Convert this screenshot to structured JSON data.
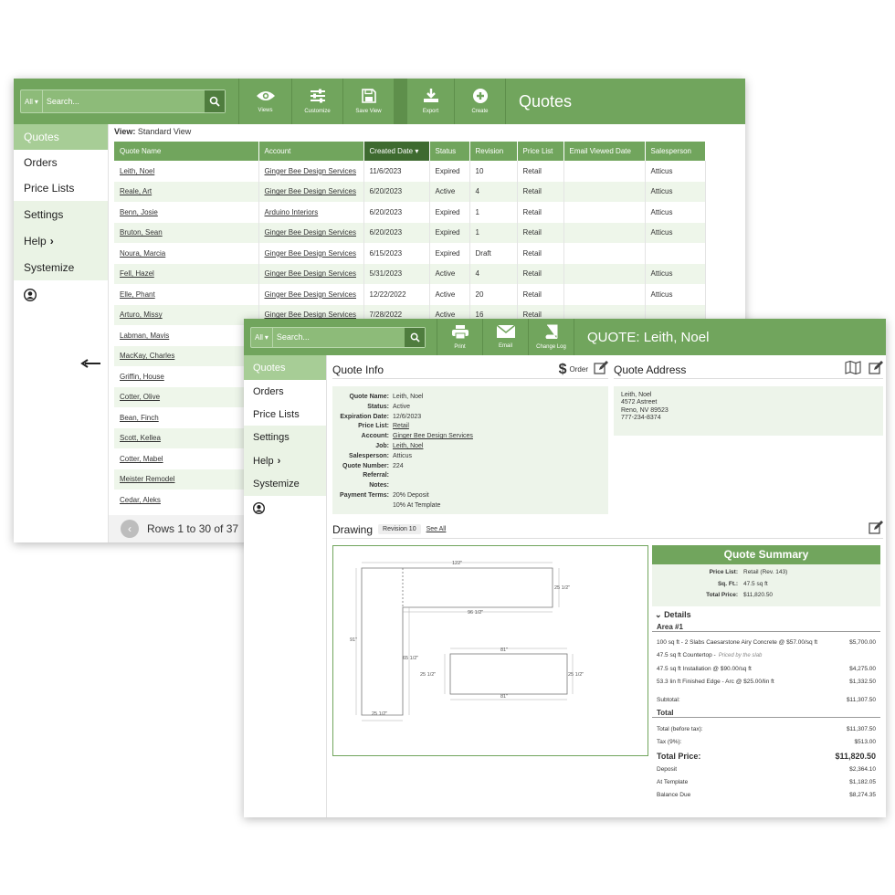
{
  "search": {
    "scope": "All",
    "placeholder": "Search..."
  },
  "window1": {
    "toolbar": {
      "views": "Views",
      "customize": "Customize",
      "save_view": "Save View",
      "export": "Export",
      "create": "Create",
      "title": "Quotes"
    },
    "sidebar": [
      "Quotes",
      "Orders",
      "Price Lists",
      "Settings",
      "Help",
      "Systemize"
    ],
    "view_label": "View:",
    "view_value": "Standard View",
    "columns": [
      "Quote Name",
      "Account",
      "Created Date",
      "Status",
      "Revision",
      "Price List",
      "Email Viewed Date",
      "Salesperson"
    ],
    "rows": [
      [
        "Leith, Noel",
        "Ginger Bee Design Services",
        "11/6/2023",
        "Expired",
        "10",
        "Retail",
        "",
        "Atticus"
      ],
      [
        "Reale, Art",
        "Ginger Bee Design Services",
        "6/20/2023",
        "Active",
        "4",
        "Retail",
        "",
        "Atticus"
      ],
      [
        "Benn, Josie",
        "Arduino Interiors",
        "6/20/2023",
        "Expired",
        "1",
        "Retail",
        "",
        "Atticus"
      ],
      [
        "Bruton, Sean",
        "Ginger Bee Design Services",
        "6/20/2023",
        "Expired",
        "1",
        "Retail",
        "",
        "Atticus"
      ],
      [
        "Noura, Marcia",
        "Ginger Bee Design Services",
        "6/15/2023",
        "Expired",
        "Draft",
        "Retail",
        "",
        ""
      ],
      [
        "Fell, Hazel",
        "Ginger Bee Design Services",
        "5/31/2023",
        "Active",
        "4",
        "Retail",
        "",
        "Atticus"
      ],
      [
        "Elle, Phant",
        "Ginger Bee Design Services",
        "12/22/2022",
        "Active",
        "20",
        "Retail",
        "",
        "Atticus"
      ],
      [
        "Arturo, Missy",
        "Ginger Bee Design Services",
        "7/28/2022",
        "Active",
        "16",
        "Retail",
        "",
        ""
      ],
      [
        "Labman, Mavis",
        "",
        "",
        "",
        "",
        "",
        "",
        ""
      ],
      [
        "MacKay, Charles",
        "",
        "",
        "",
        "",
        "",
        "",
        ""
      ],
      [
        "Griffin, House",
        "",
        "",
        "",
        "",
        "",
        "",
        ""
      ],
      [
        "Cotter, Olive",
        "",
        "",
        "",
        "",
        "",
        "",
        ""
      ],
      [
        "Bean, Finch",
        "",
        "",
        "",
        "",
        "",
        "",
        ""
      ],
      [
        "Scott, Kellea",
        "",
        "",
        "",
        "",
        "",
        "",
        ""
      ],
      [
        "Cotter, Mabel",
        "",
        "",
        "",
        "",
        "",
        "",
        ""
      ],
      [
        "Meister Remodel",
        "",
        "",
        "",
        "",
        "",
        "",
        ""
      ],
      [
        "Cedar, Aleks",
        "",
        "",
        "",
        "",
        "",
        "",
        ""
      ]
    ],
    "pagination": "Rows 1 to 30 of 37"
  },
  "window2": {
    "toolbar": {
      "print": "Print",
      "email": "Email",
      "change_log": "Change Log",
      "title_prefix": "QUOTE:",
      "title_name": "Leith, Noel"
    },
    "sidebar": [
      "Quotes",
      "Orders",
      "Price Lists",
      "Settings",
      "Help",
      "Systemize"
    ],
    "quote_info": {
      "title": "Quote Info",
      "order_label": "Order",
      "fields": [
        {
          "k": "Quote Name:",
          "v": "Leith, Noel"
        },
        {
          "k": "Status:",
          "v": "Active"
        },
        {
          "k": "Expiration Date:",
          "v": "12/6/2023"
        },
        {
          "k": "Price List:",
          "v": "Retail"
        },
        {
          "k": "Account:",
          "v": "Ginger Bee Design Services"
        },
        {
          "k": "Job:",
          "v": "Leith, Noel"
        },
        {
          "k": "Salesperson:",
          "v": "Atticus"
        },
        {
          "k": "Quote Number:",
          "v": "224"
        },
        {
          "k": "Referral:",
          "v": ""
        },
        {
          "k": "Notes:",
          "v": ""
        },
        {
          "k": "Payment Terms:",
          "v": "20% Deposit"
        },
        {
          "k": "",
          "v": "10% At Template"
        }
      ]
    },
    "quote_address": {
      "title": "Quote Address",
      "lines": [
        "Leith, Noel",
        "4572 Astreet",
        "Reno, NV 89523",
        "777-234-8374"
      ]
    },
    "drawing": {
      "title": "Drawing",
      "revision": "Revision 10",
      "see_all": "See All",
      "dims": {
        "top": "122\"",
        "right_short": "25 1/2\"",
        "inner_h": "96 1/2\"",
        "left": "91\"",
        "bottom_left": "25 1/2\"",
        "inner_v": "65 1/2\"",
        "island_top": "81\"",
        "island_bottom": "81\"",
        "island_left": "25 1/2\"",
        "island_right": "25 1/2\""
      }
    },
    "summary": {
      "title": "Quote Summary",
      "top": [
        {
          "k": "Price List:",
          "v": "Retail (Rev. 143)"
        },
        {
          "k": "Sq. Ft.:",
          "v": "47.5 sq ft"
        },
        {
          "k": "Total Price:",
          "v": "$11,820.50"
        }
      ],
      "details_label": "Details",
      "area": "Area #1",
      "lines": [
        {
          "d": "100 sq ft - 2 Slabs Caesarstone Airy Concrete @ $57.00/sq ft",
          "v": "$5,700.00"
        },
        {
          "d": "47.5 sq ft Countertop -",
          "note": "Priced by the slab",
          "v": ""
        },
        {
          "d": "47.5 sq ft Installation @ $90.00/sq ft",
          "v": "$4,275.00"
        },
        {
          "d": "53.3 lin ft Finished Edge - Arc @ $25.00/lin ft",
          "v": "$1,332.50"
        }
      ],
      "subtotal": {
        "k": "Subtotal:",
        "v": "$11,307.50"
      },
      "total_label": "Total",
      "before_tax": {
        "k": "Total (before tax):",
        "v": "$11,307.50"
      },
      "tax": {
        "k": "Tax (9%):",
        "v": "$513.00"
      },
      "total_price": {
        "k": "Total Price:",
        "v": "$11,820.50"
      },
      "deposit": {
        "k": "Deposit",
        "v": "$2,364.10"
      },
      "at_template": {
        "k": "At Template",
        "v": "$1,182.05"
      },
      "balance": {
        "k": "Balance Due",
        "v": "$8,274.35"
      }
    }
  }
}
